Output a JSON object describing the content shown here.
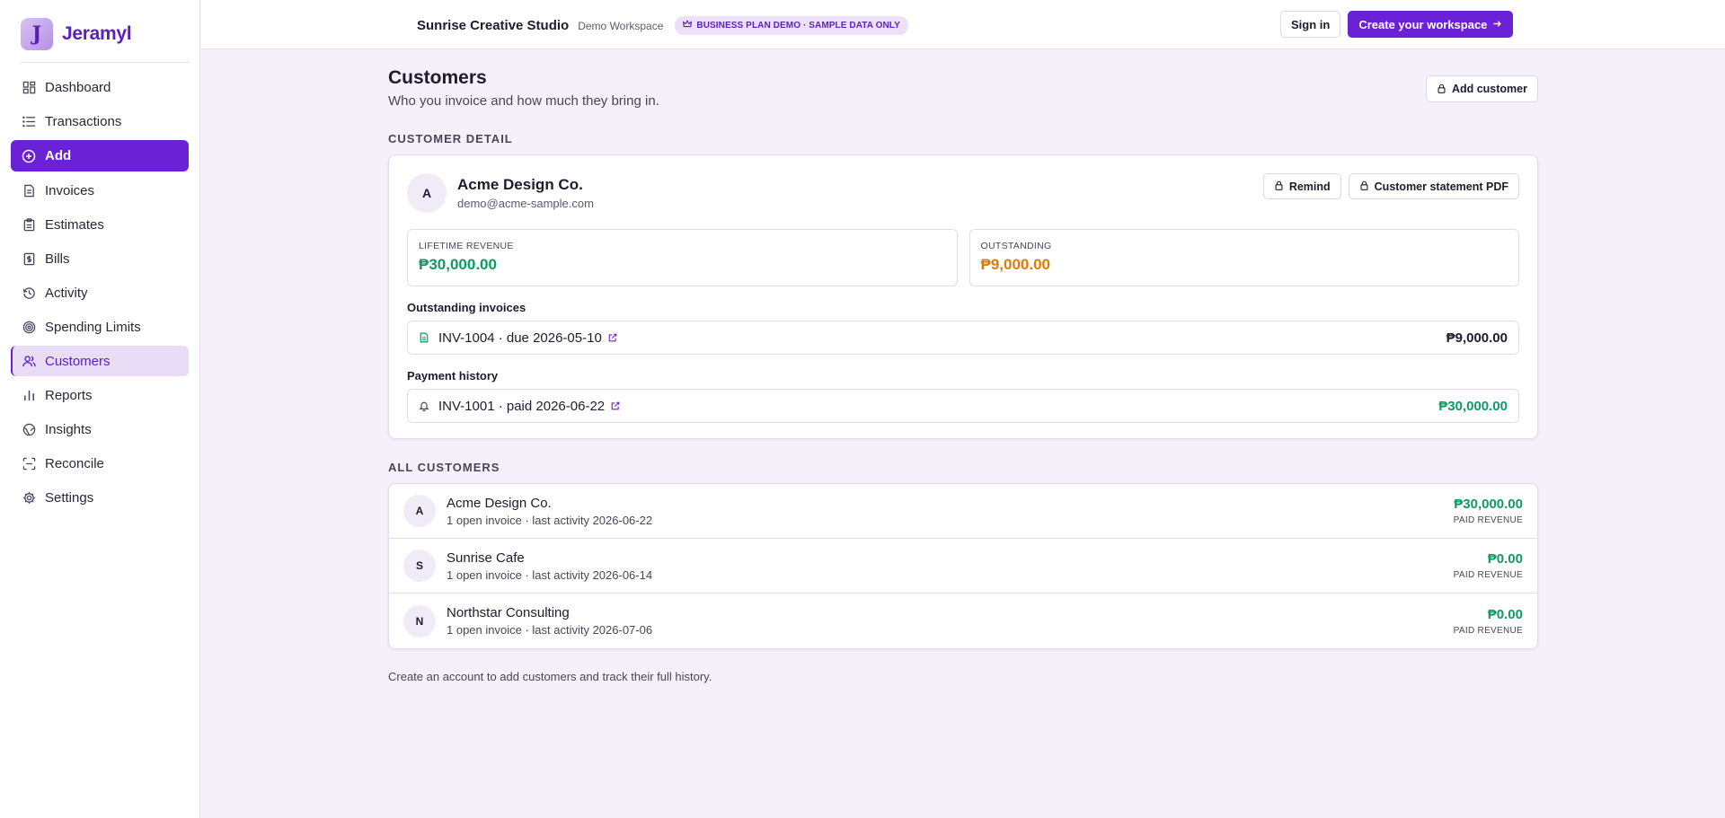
{
  "brand": {
    "logo_letter": "J",
    "name": "Jeramyl"
  },
  "sidebar": {
    "items": [
      {
        "label": "Dashboard",
        "icon": "dashboard-icon"
      },
      {
        "label": "Transactions",
        "icon": "list-icon"
      },
      {
        "label": "Add",
        "icon": "plus-circle-icon"
      },
      {
        "label": "Invoices",
        "icon": "document-icon"
      },
      {
        "label": "Estimates",
        "icon": "clipboard-icon"
      },
      {
        "label": "Bills",
        "icon": "bill-icon"
      },
      {
        "label": "Activity",
        "icon": "history-icon"
      },
      {
        "label": "Spending Limits",
        "icon": "target-icon"
      },
      {
        "label": "Customers",
        "icon": "users-icon"
      },
      {
        "label": "Reports",
        "icon": "bar-chart-icon"
      },
      {
        "label": "Insights",
        "icon": "globe-icon"
      },
      {
        "label": "Reconcile",
        "icon": "scan-icon"
      },
      {
        "label": "Settings",
        "icon": "gear-icon"
      }
    ]
  },
  "topbar": {
    "workspace_name": "Sunrise Creative Studio",
    "workspace_sub": "Demo Workspace",
    "plan_badge": "BUSINESS PLAN DEMO · SAMPLE DATA ONLY",
    "sign_in": "Sign in",
    "create_workspace": "Create your workspace"
  },
  "page": {
    "title": "Customers",
    "subtitle": "Who you invoice and how much they bring in.",
    "add_customer": "Add customer"
  },
  "detail": {
    "section_label": "CUSTOMER DETAIL",
    "avatar": "A",
    "name": "Acme Design Co.",
    "email": "demo@acme-sample.com",
    "remind": "Remind",
    "statement": "Customer statement PDF",
    "lifetime_label": "LIFETIME REVENUE",
    "lifetime_value": "₱30,000.00",
    "outstanding_label": "OUTSTANDING",
    "outstanding_value": "₱9,000.00",
    "outstanding_head": "Outstanding invoices",
    "outstanding_invoice": "INV-1004 · due 2026-05-10",
    "outstanding_amount": "₱9,000.00",
    "history_head": "Payment history",
    "history_invoice": "INV-1001 · paid 2026-06-22",
    "history_amount": "₱30,000.00"
  },
  "all_customers": {
    "section_label": "ALL CUSTOMERS",
    "amount_label": "PAID REVENUE",
    "rows": [
      {
        "avatar": "A",
        "name": "Acme Design Co.",
        "meta": "1 open invoice · last activity 2026-06-22",
        "amount": "₱30,000.00"
      },
      {
        "avatar": "S",
        "name": "Sunrise Cafe",
        "meta": "1 open invoice · last activity 2026-06-14",
        "amount": "₱0.00"
      },
      {
        "avatar": "N",
        "name": "Northstar Consulting",
        "meta": "1 open invoice · last activity 2026-07-06",
        "amount": "₱0.00"
      }
    ]
  },
  "footer_note": "Create an account to add customers and track their full history.",
  "colors": {
    "accent": "#6b21d6",
    "positive": "#0f9a63",
    "warning": "#de7a08",
    "background": "#f6f0fb"
  }
}
